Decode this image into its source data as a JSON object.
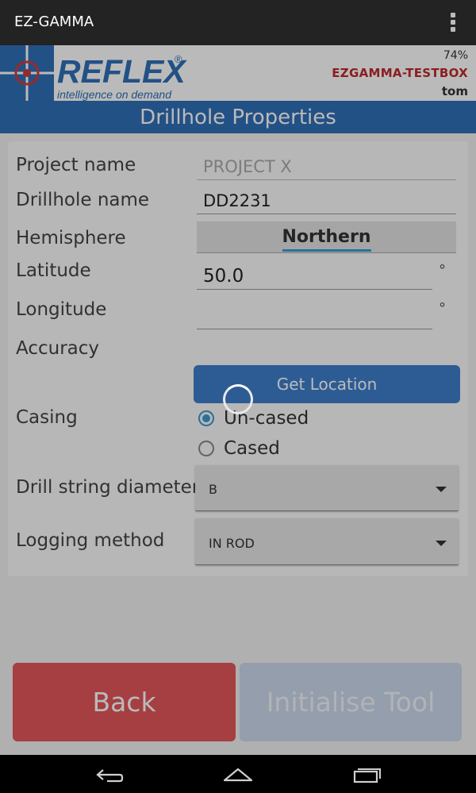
{
  "app": {
    "title": "EZ-GAMMA"
  },
  "header": {
    "brand": "REFLEX",
    "tagline": "intelligence on demand",
    "battery": "74%",
    "device": "EZGAMMA-TESTBOX",
    "user": "tom"
  },
  "banner": {
    "title": "Drillhole Properties"
  },
  "form": {
    "project_label": "Project name",
    "project_value": "PROJECT X",
    "drillhole_label": "Drillhole name",
    "drillhole_value": "DD2231",
    "hemisphere_label": "Hemisphere",
    "hemisphere_value": "Northern",
    "latitude_label": "Latitude",
    "latitude_value": "50.0",
    "longitude_label": "Longitude",
    "longitude_value": "",
    "degree_symbol": "°",
    "accuracy_label": "Accuracy",
    "get_location_label": "Get Location",
    "casing_label": "Casing",
    "casing_options": [
      "Un-cased",
      "Cased"
    ],
    "casing_selected": "Un-cased",
    "drill_string_label": "Drill string diameter",
    "drill_string_value": "B",
    "logging_label": "Logging method",
    "logging_value": "IN ROD"
  },
  "buttons": {
    "back": "Back",
    "initialise": "Initialise Tool"
  },
  "colors": {
    "brand_blue": "#2f6fb7",
    "accent_red": "#c0282b",
    "back_red": "#e3575b"
  }
}
